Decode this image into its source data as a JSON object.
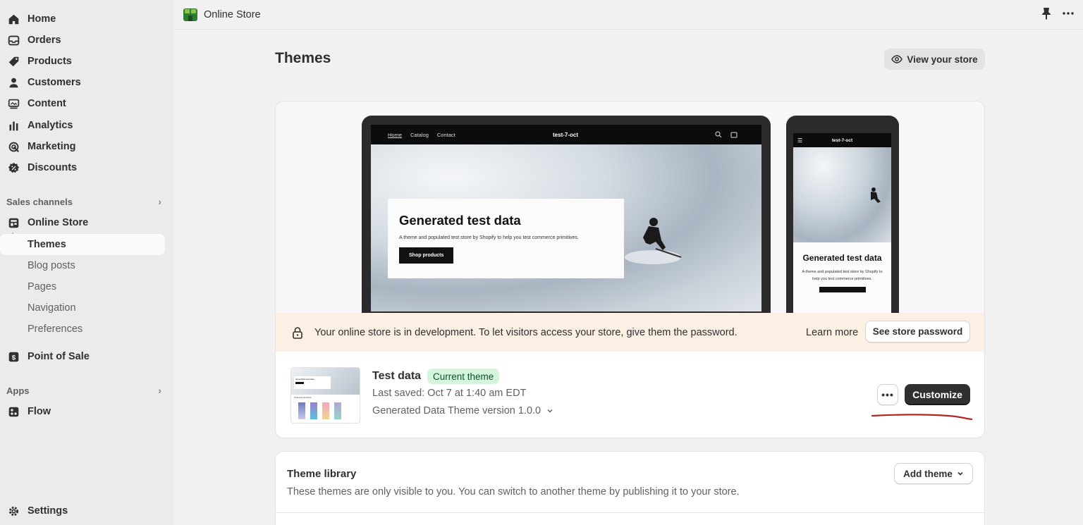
{
  "sidebar": {
    "items": [
      {
        "label": "Home",
        "icon": "home-icon"
      },
      {
        "label": "Orders",
        "icon": "inbox-icon"
      },
      {
        "label": "Products",
        "icon": "tag-icon"
      },
      {
        "label": "Customers",
        "icon": "person-icon"
      },
      {
        "label": "Content",
        "icon": "image-icon"
      },
      {
        "label": "Analytics",
        "icon": "bar-chart-icon"
      },
      {
        "label": "Marketing",
        "icon": "target-icon"
      },
      {
        "label": "Discounts",
        "icon": "discount-icon"
      }
    ],
    "sales_channels_label": "Sales channels",
    "online_store": {
      "label": "Online Store",
      "icon": "store-icon"
    },
    "online_store_sub": [
      "Themes",
      "Blog posts",
      "Pages",
      "Navigation",
      "Preferences"
    ],
    "pos": {
      "label": "Point of Sale",
      "icon": "pos-icon"
    },
    "apps_label": "Apps",
    "flow": {
      "label": "Flow",
      "icon": "flow-icon"
    },
    "settings": {
      "label": "Settings",
      "icon": "gear-icon"
    }
  },
  "topbar": {
    "title": "Online Store"
  },
  "page": {
    "title": "Themes",
    "view_store_label": "View your store"
  },
  "preview": {
    "laptop_nav": [
      "Home",
      "Catalog",
      "Contact"
    ],
    "store_name": "test-7-oct",
    "hero_title": "Generated test data",
    "hero_text": "A theme and populated test store by Shopify to help you test commerce primitives.",
    "hero_button": "Shop products",
    "phone_title": "Generated test data",
    "phone_text": "A theme and populated test store by Shopify to help you test commerce primitives."
  },
  "banner": {
    "message": "Your online store is in development. To let visitors access your store, give them the password.",
    "learn_more": "Learn more",
    "password_button": "See store password"
  },
  "current_theme": {
    "name": "Test data",
    "badge": "Current theme",
    "last_saved": "Last saved: Oct 7 at 1:40 am EDT",
    "version": "Generated Data Theme version 1.0.0",
    "more_label": "•••",
    "customize_label": "Customize",
    "thumb_title": "Generated test data",
    "thumb_section": "Featured products"
  },
  "library": {
    "title": "Theme library",
    "description": "These themes are only visible to you. You can switch to another theme by publishing it to your store.",
    "add_theme_label": "Add theme"
  },
  "colors": {
    "accent_badge": "#d5f5dc",
    "banner_bg": "#fcefe3",
    "annotation_red": "#b3261e"
  }
}
